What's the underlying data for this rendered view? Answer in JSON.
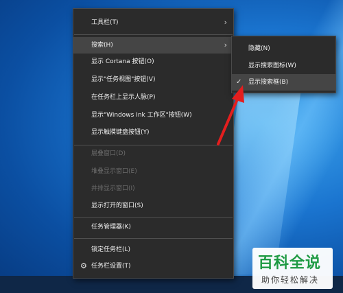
{
  "main_menu": {
    "toolbars": "工具栏(T)",
    "search": "搜索(H)",
    "show_cortana": "显示 Cortana 按钮(O)",
    "show_task_view": "显示\"任务视图\"按钮(V)",
    "show_people": "在任务栏上显示人脉(P)",
    "show_ink_workspace": "显示\"Windows Ink 工作区\"按钮(W)",
    "show_touch_keyboard": "显示触摸键盘按钮(Y)",
    "cascade_windows": "层叠窗口(D)",
    "stack_windows": "堆叠显示窗口(E)",
    "side_by_side": "并排显示窗口(I)",
    "show_open_windows": "显示打开的窗口(S)",
    "task_manager": "任务管理器(K)",
    "lock_taskbar": "锁定任务栏(L)",
    "taskbar_settings": "任务栏设置(T)"
  },
  "search_submenu": {
    "hidden": "隐藏(N)",
    "show_search_icon": "显示搜索图标(W)",
    "show_search_box": "显示搜索框(B)",
    "selected": "show_search_box"
  },
  "icons": {
    "submenu_arrow": "›",
    "settings": "⚙",
    "check": "✓"
  },
  "watermark": {
    "title": "百科全说",
    "subtitle": "助你轻松解决"
  },
  "colors": {
    "menu_bg": "#2b2b2b",
    "highlight": "#454545",
    "arrow": "#e41e1e",
    "watermark_green": "#1e9a43"
  }
}
